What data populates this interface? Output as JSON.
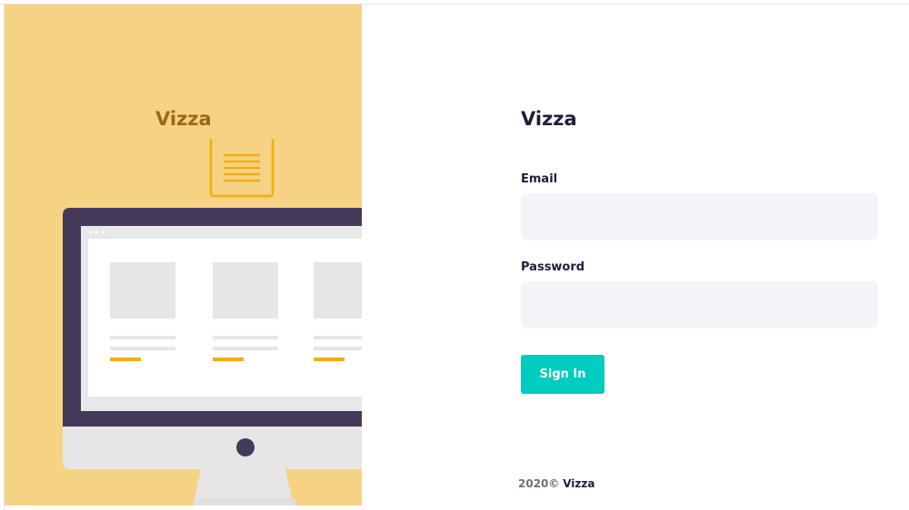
{
  "hero": {
    "brand": "Vizza"
  },
  "login": {
    "brand_title": "Vizza",
    "email_label": "Email",
    "email_value": "",
    "password_label": "Password",
    "password_value": "",
    "signin_label": "Sign In"
  },
  "footer": {
    "year": "2020©",
    "name": "Vizza"
  },
  "colors": {
    "hero_background": "#f6d285",
    "accent_button": "#00ccc0",
    "input_background": "#f2f4f7",
    "monitor_frame": "#463a5a",
    "illustration_accent": "#f5ac0f"
  }
}
